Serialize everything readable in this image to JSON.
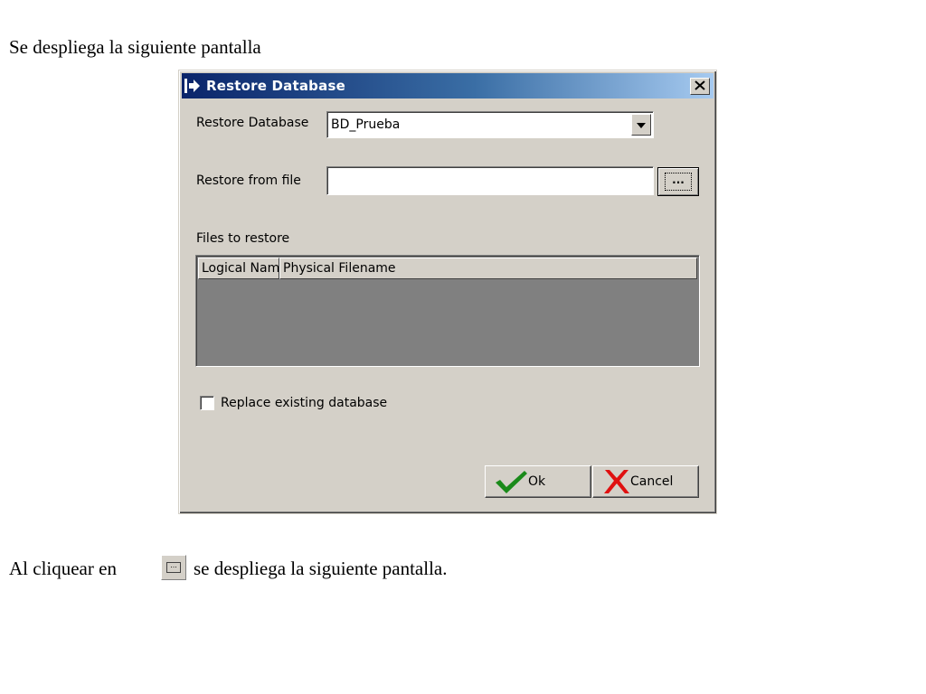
{
  "document": {
    "intro_text": "Se despliega la siguiente pantalla",
    "outro_before": "Al cliquear en",
    "outro_after": "se despliega la siguiente pantalla.",
    "inline_icon": "browse-button-icon"
  },
  "dialog": {
    "title": "Restore Database",
    "title_icon": "arrow-right-icon",
    "close_icon": "close-icon",
    "restore_database_label": "Restore Database",
    "restore_database_value": "BD_Prueba",
    "restore_from_file_label": "Restore from file",
    "restore_from_file_value": "",
    "browse_label": "...",
    "files_to_restore_label": "Files to restore",
    "files_columns": [
      "Logical Name",
      "Physical Filename"
    ],
    "files_rows": [],
    "replace_existing_label": "Replace existing database",
    "replace_existing_checked": false,
    "ok_label": "Ok",
    "cancel_label": "Cancel",
    "ok_icon": "checkmark-icon",
    "cancel_icon": "red-x-icon"
  },
  "colors": {
    "titlebar_start": "#0a246a",
    "titlebar_end": "#a6caf0",
    "window_face": "#d4d0c8",
    "list_background": "#808080",
    "ok_icon_color": "#1a8a1a",
    "cancel_icon_color": "#e01010"
  }
}
